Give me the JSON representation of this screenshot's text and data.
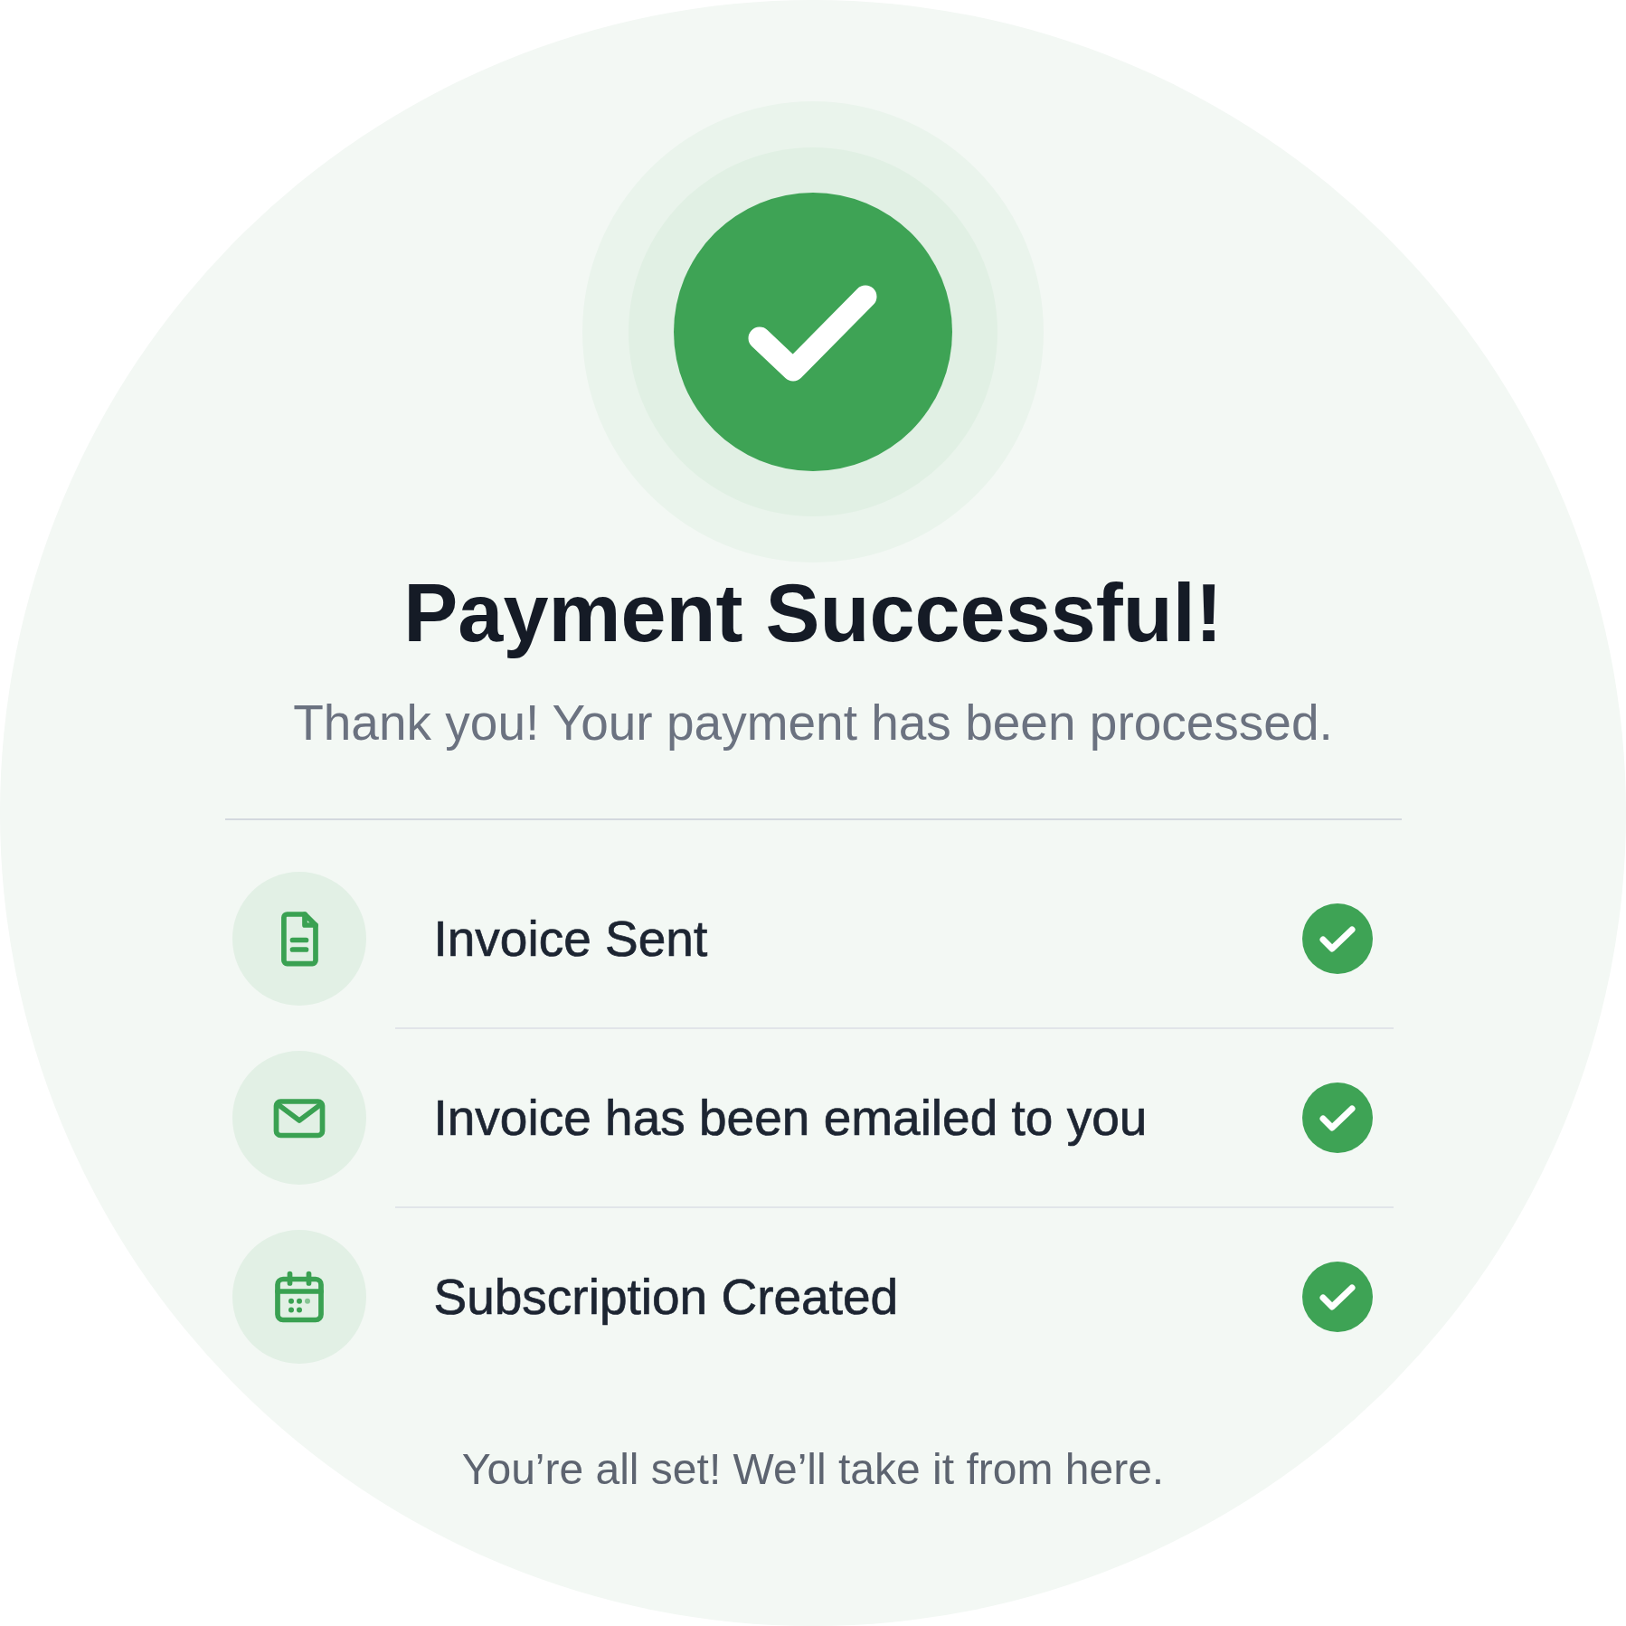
{
  "header": {
    "title": "Payment Successful!",
    "subtitle": "Thank you! Your payment has been processed."
  },
  "steps": [
    {
      "kind": "document",
      "label": "Invoice Sent",
      "completed": true
    },
    {
      "kind": "email",
      "label": "Invoice has been emailed to you",
      "completed": true
    },
    {
      "kind": "calendar",
      "label": "Subscription Created",
      "completed": true
    }
  ],
  "footer": {
    "message": "You’re all set! We’ll take it from here."
  }
}
